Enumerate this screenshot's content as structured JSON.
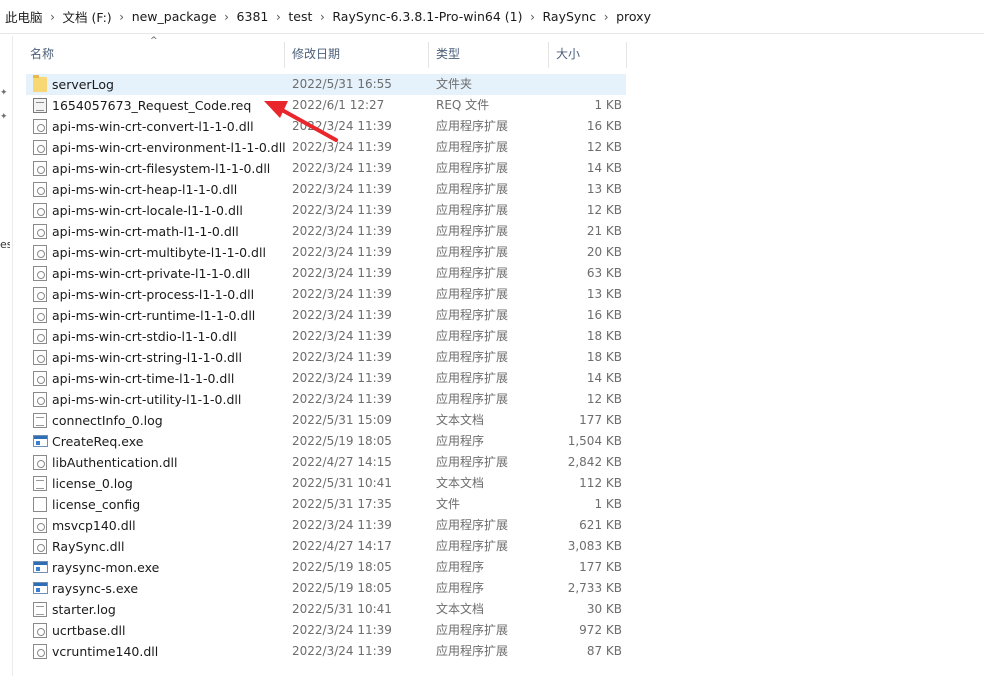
{
  "breadcrumb": [
    "此电脑",
    "文档 (F:)",
    "new_package",
    "6381",
    "test",
    "RaySync-6.3.8.1-Pro-win64 (1)",
    "RaySync",
    "proxy"
  ],
  "columns": {
    "name": "名称",
    "date": "修改日期",
    "type": "类型",
    "size": "大小"
  },
  "nav": {
    "fragment": "es"
  },
  "files": [
    {
      "name": "serverLog",
      "date": "2022/5/31 16:55",
      "type": "文件夹",
      "size": "",
      "icon": "folder-icon",
      "selected": true
    },
    {
      "name": "1654057673_Request_Code.req",
      "date": "2022/6/1 12:27",
      "type": "REQ 文件",
      "size": "1 KB",
      "icon": "req-file-icon"
    },
    {
      "name": "api-ms-win-crt-convert-l1-1-0.dll",
      "date": "2022/3/24 11:39",
      "type": "应用程序扩展",
      "size": "16 KB",
      "icon": "dll-file-icon"
    },
    {
      "name": "api-ms-win-crt-environment-l1-1-0.dll",
      "date": "2022/3/24 11:39",
      "type": "应用程序扩展",
      "size": "12 KB",
      "icon": "dll-file-icon"
    },
    {
      "name": "api-ms-win-crt-filesystem-l1-1-0.dll",
      "date": "2022/3/24 11:39",
      "type": "应用程序扩展",
      "size": "14 KB",
      "icon": "dll-file-icon"
    },
    {
      "name": "api-ms-win-crt-heap-l1-1-0.dll",
      "date": "2022/3/24 11:39",
      "type": "应用程序扩展",
      "size": "13 KB",
      "icon": "dll-file-icon"
    },
    {
      "name": "api-ms-win-crt-locale-l1-1-0.dll",
      "date": "2022/3/24 11:39",
      "type": "应用程序扩展",
      "size": "12 KB",
      "icon": "dll-file-icon"
    },
    {
      "name": "api-ms-win-crt-math-l1-1-0.dll",
      "date": "2022/3/24 11:39",
      "type": "应用程序扩展",
      "size": "21 KB",
      "icon": "dll-file-icon"
    },
    {
      "name": "api-ms-win-crt-multibyte-l1-1-0.dll",
      "date": "2022/3/24 11:39",
      "type": "应用程序扩展",
      "size": "20 KB",
      "icon": "dll-file-icon"
    },
    {
      "name": "api-ms-win-crt-private-l1-1-0.dll",
      "date": "2022/3/24 11:39",
      "type": "应用程序扩展",
      "size": "63 KB",
      "icon": "dll-file-icon"
    },
    {
      "name": "api-ms-win-crt-process-l1-1-0.dll",
      "date": "2022/3/24 11:39",
      "type": "应用程序扩展",
      "size": "13 KB",
      "icon": "dll-file-icon"
    },
    {
      "name": "api-ms-win-crt-runtime-l1-1-0.dll",
      "date": "2022/3/24 11:39",
      "type": "应用程序扩展",
      "size": "16 KB",
      "icon": "dll-file-icon"
    },
    {
      "name": "api-ms-win-crt-stdio-l1-1-0.dll",
      "date": "2022/3/24 11:39",
      "type": "应用程序扩展",
      "size": "18 KB",
      "icon": "dll-file-icon"
    },
    {
      "name": "api-ms-win-crt-string-l1-1-0.dll",
      "date": "2022/3/24 11:39",
      "type": "应用程序扩展",
      "size": "18 KB",
      "icon": "dll-file-icon"
    },
    {
      "name": "api-ms-win-crt-time-l1-1-0.dll",
      "date": "2022/3/24 11:39",
      "type": "应用程序扩展",
      "size": "14 KB",
      "icon": "dll-file-icon"
    },
    {
      "name": "api-ms-win-crt-utility-l1-1-0.dll",
      "date": "2022/3/24 11:39",
      "type": "应用程序扩展",
      "size": "12 KB",
      "icon": "dll-file-icon"
    },
    {
      "name": "connectInfo_0.log",
      "date": "2022/5/31 15:09",
      "type": "文本文档",
      "size": "177 KB",
      "icon": "log-file-icon"
    },
    {
      "name": "CreateReq.exe",
      "date": "2022/5/19 18:05",
      "type": "应用程序",
      "size": "1,504 KB",
      "icon": "exe-file-icon"
    },
    {
      "name": "libAuthentication.dll",
      "date": "2022/4/27 14:15",
      "type": "应用程序扩展",
      "size": "2,842 KB",
      "icon": "dll-file-icon"
    },
    {
      "name": "license_0.log",
      "date": "2022/5/31 10:41",
      "type": "文本文档",
      "size": "112 KB",
      "icon": "log-file-icon"
    },
    {
      "name": "license_config",
      "date": "2022/5/31 17:35",
      "type": "文件",
      "size": "1 KB",
      "icon": "blank-file-icon"
    },
    {
      "name": "msvcp140.dll",
      "date": "2022/3/24 11:39",
      "type": "应用程序扩展",
      "size": "621 KB",
      "icon": "dll-file-icon"
    },
    {
      "name": "RaySync.dll",
      "date": "2022/4/27 14:17",
      "type": "应用程序扩展",
      "size": "3,083 KB",
      "icon": "dll-file-icon"
    },
    {
      "name": "raysync-mon.exe",
      "date": "2022/5/19 18:05",
      "type": "应用程序",
      "size": "177 KB",
      "icon": "exe-file-icon"
    },
    {
      "name": "raysync-s.exe",
      "date": "2022/5/19 18:05",
      "type": "应用程序",
      "size": "2,733 KB",
      "icon": "exe-file-icon"
    },
    {
      "name": "starter.log",
      "date": "2022/5/31 10:41",
      "type": "文本文档",
      "size": "30 KB",
      "icon": "log-file-icon"
    },
    {
      "name": "ucrtbase.dll",
      "date": "2022/3/24 11:39",
      "type": "应用程序扩展",
      "size": "972 KB",
      "icon": "dll-file-icon"
    },
    {
      "name": "vcruntime140.dll",
      "date": "2022/3/24 11:39",
      "type": "应用程序扩展",
      "size": "87 KB",
      "icon": "dll-file-icon"
    }
  ],
  "annotation": {
    "color": "#e8262b"
  }
}
